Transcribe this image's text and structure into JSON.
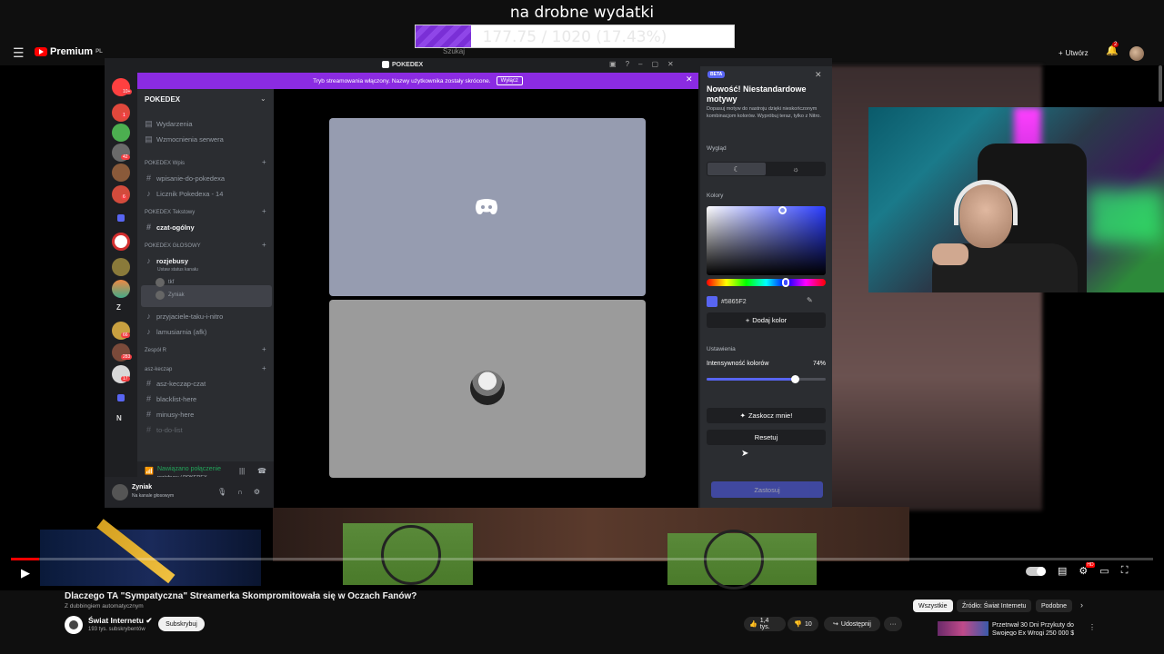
{
  "overlay": {
    "goal_title": "na drobne wydatki",
    "goal_text": "177.75 / 1020 (17.43%)",
    "goal_progress": 0.1743
  },
  "youtube": {
    "header": {
      "menu_icon": "hamburger-icon",
      "logo_text": "Premium",
      "logo_region": "PL",
      "search_placeholder": "Szukaj",
      "create_label": "Utwórz",
      "notification_count": "2"
    },
    "video": {
      "title": "Dlaczego TA \"Sympatyczna\" Streamerka Skompromitowała się w Oczach Fanów?",
      "dubbing": "Z dubbingiem automatycznym",
      "progress": 0.025
    },
    "channel": {
      "name": "Świat Internetu",
      "subscribers": "193 tys. subskrybentów",
      "subscribe_label": "Subskrybuj"
    },
    "actions": {
      "likes": "1,4 tys.",
      "dislikes": "10",
      "share_label": "Udostępnij",
      "more_label": "···"
    },
    "chips": [
      "Wszystkie",
      "Źródło: Świat Internetu",
      "Podobne"
    ],
    "recommendation": {
      "title": "Przetrwał 30 Dni Przykuty do Swojego Ex Wrogi 250 000 $"
    }
  },
  "discord": {
    "window_title": "POKEDEX",
    "banner_text": "Tryb streamowania włączony. Nazwy użytkownika zostały skrócone.",
    "banner_button": "Wyłącz",
    "guild_name": "POKEDEX",
    "rail_labels": {
      "s1": "Z",
      "s2": "N"
    },
    "rail_badges": {
      "top": "10+",
      "b1": "1",
      "b2": "42",
      "b3": "6",
      "b4": "66",
      "b5": "283",
      "b6": "17"
    },
    "top_items": [
      "Wydarzenia",
      "Wzmocnienia serwera"
    ],
    "categories": {
      "wpis": "POKEDEX Wpis",
      "text": "POKEDEX Tekstowy",
      "voice": "POKEDEX GŁOSOWY",
      "team": "Zespół R",
      "asz": "asz-keczap"
    },
    "channels": {
      "wpisanie": "wpisanie-do-pokedexa",
      "licznik": "Licznik Pokedexa - 14",
      "czat": "czat-ogólny",
      "rozjebusy": "rozjebusy",
      "status": "Ustaw status kanału",
      "przyjaciele": "przyjaciele-taku-i-nitro",
      "lamusiarnia": "lamusiarnia (afk)",
      "asz_czat": "asz-keczap-czat",
      "blacklist": "blacklist-here",
      "minusy": "minusy-here",
      "todo": "to-do-list"
    },
    "voice_users": [
      "tkf",
      "Zyniak"
    ],
    "connection": {
      "status": "Nawiązano połączenie",
      "location": "rozjebusy / POKEDEX"
    },
    "user": {
      "name": "Zyniak",
      "status": "Na kanale głosowym"
    },
    "theme_panel": {
      "badge": "BETA",
      "title": "Nowość! Niestandardowe motywy",
      "description": "Dopasuj motyw do nastroju dzięki nieskończonym kombinacjom kolorów. Wypróbuj teraz, tylko z Nitro.",
      "appearance_label": "Wygląd",
      "colors_label": "Kolory",
      "hex_value": "#5865F2",
      "add_color": "Dodaj kolor",
      "settings_label": "Ustawienia",
      "intensity_label": "Intensywność kolorów",
      "intensity_value": "74%",
      "intensity": 0.74,
      "surprise_label": "Zaskocz mnie!",
      "reset_label": "Resetuj",
      "apply_label": "Zastosuj"
    }
  },
  "colors": {
    "accent": "#5865F2",
    "banner": "#8B2BE2",
    "connected": "#23A55A",
    "yt_red": "#FF0000"
  }
}
